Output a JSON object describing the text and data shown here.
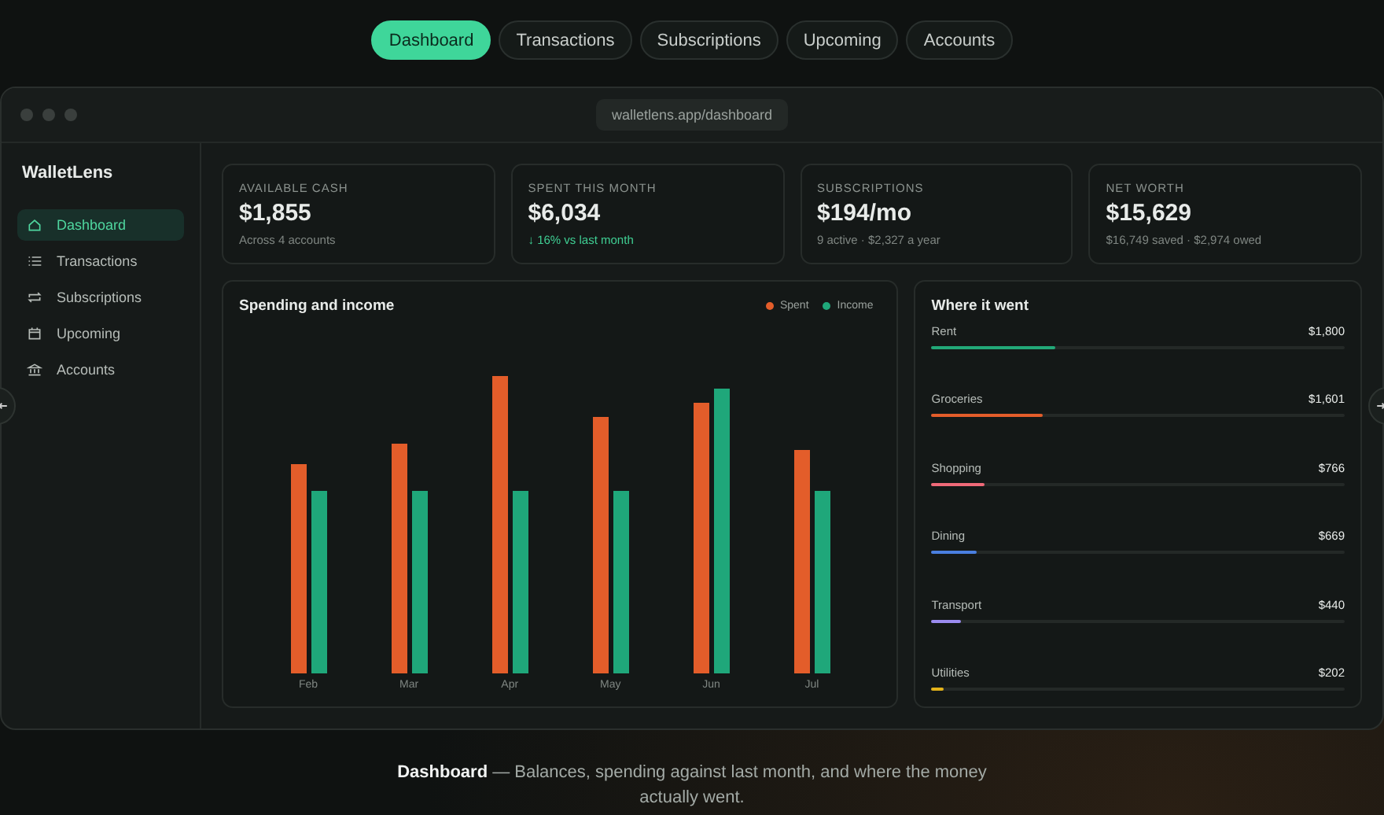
{
  "top_tabs": [
    {
      "label": "Dashboard",
      "selected": true
    },
    {
      "label": "Transactions",
      "selected": false
    },
    {
      "label": "Subscriptions",
      "selected": false
    },
    {
      "label": "Upcoming",
      "selected": false
    },
    {
      "label": "Accounts",
      "selected": false
    }
  ],
  "window": {
    "url": "walletlens.app/dashboard"
  },
  "sidebar": {
    "brand": "WalletLens",
    "items": [
      {
        "label": "Dashboard",
        "selected": true
      },
      {
        "label": "Transactions",
        "selected": false
      },
      {
        "label": "Subscriptions",
        "selected": false
      },
      {
        "label": "Upcoming",
        "selected": false
      },
      {
        "label": "Accounts",
        "selected": false
      }
    ]
  },
  "stats": [
    {
      "label": "AVAILABLE CASH",
      "value": "$1,855",
      "note": "Across 4 accounts",
      "kind": "plain"
    },
    {
      "label": "SPENT THIS MONTH",
      "value": "$6,034",
      "note": "↓ 16% vs last month",
      "kind": "good"
    },
    {
      "label": "SUBSCRIPTIONS",
      "value": "$194/mo",
      "note": "9 active · $2,327 a year",
      "kind": "plain"
    },
    {
      "label": "NET WORTH",
      "value": "$15,629",
      "note": "$16,749 saved · $2,974 owed",
      "kind": "plain"
    }
  ],
  "spending_chart": {
    "title": "Spending and income",
    "legend": [
      {
        "label": "Spent",
        "color": "#e35d2a"
      },
      {
        "label": "Income",
        "color": "#1fa77a"
      }
    ],
    "months": [
      "Feb",
      "Mar",
      "Apr",
      "May",
      "Jun",
      "Jul"
    ]
  },
  "where_it_went": {
    "title": "Where it went",
    "items": [
      {
        "name": "Rent",
        "amount": "$1,800",
        "level": 0.3,
        "color": "#22a878"
      },
      {
        "name": "Groceries",
        "amount": "$1,601",
        "level": 0.27,
        "color": "#e35d2a"
      },
      {
        "name": "Shopping",
        "amount": "$766",
        "level": 0.13,
        "color": "#f06a78"
      },
      {
        "name": "Dining",
        "amount": "$669",
        "level": 0.11,
        "color": "#4a7fe0"
      },
      {
        "name": "Transport",
        "amount": "$440",
        "level": 0.07,
        "color": "#9b8cf0"
      },
      {
        "name": "Utilities",
        "amount": "$202",
        "level": 0.03,
        "color": "#e3b21a"
      }
    ]
  },
  "caption": "**Dashboard** — Balances, spending against last month, and where the money actually went."
}
